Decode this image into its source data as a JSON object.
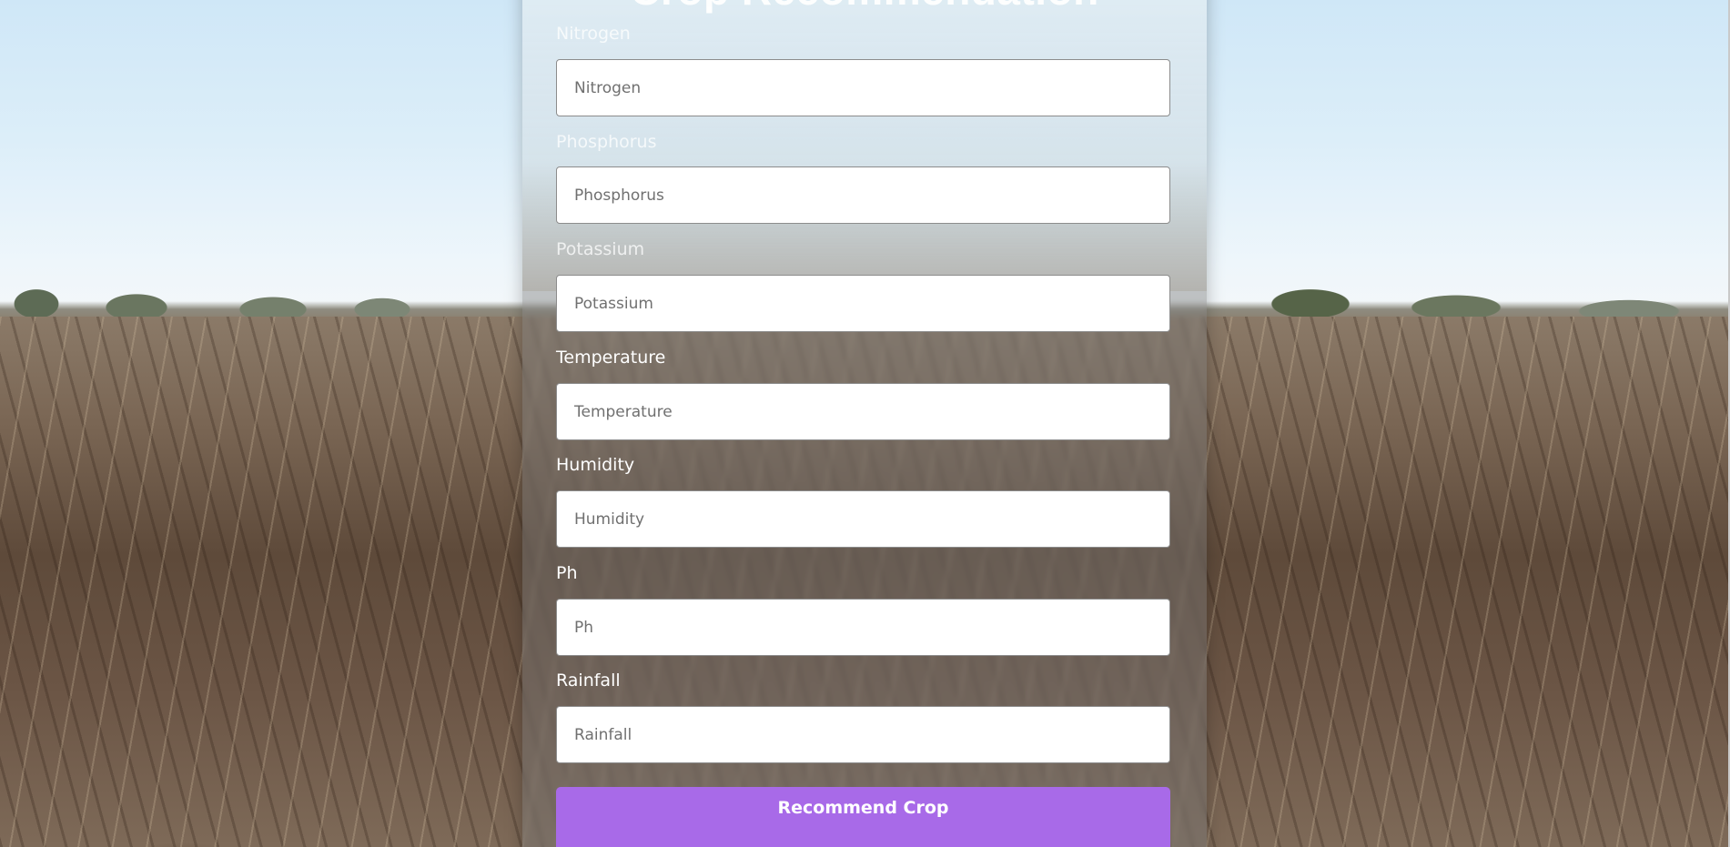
{
  "form": {
    "title": "Crop Recommendation",
    "fields": [
      {
        "label": "Nitrogen",
        "placeholder": "Nitrogen",
        "value": ""
      },
      {
        "label": "Phosphorus",
        "placeholder": "Phosphorus",
        "value": ""
      },
      {
        "label": "Potassium",
        "placeholder": "Potassium",
        "value": ""
      },
      {
        "label": "Temperature",
        "placeholder": "Temperature",
        "value": ""
      },
      {
        "label": "Humidity",
        "placeholder": "Humidity",
        "value": ""
      },
      {
        "label": "Ph",
        "placeholder": "Ph",
        "value": ""
      },
      {
        "label": "Rainfall",
        "placeholder": "Rainfall",
        "value": ""
      }
    ],
    "submit_label": "Recommend Crop"
  },
  "colors": {
    "button": "#a86ae8",
    "label": "#ffffff"
  }
}
